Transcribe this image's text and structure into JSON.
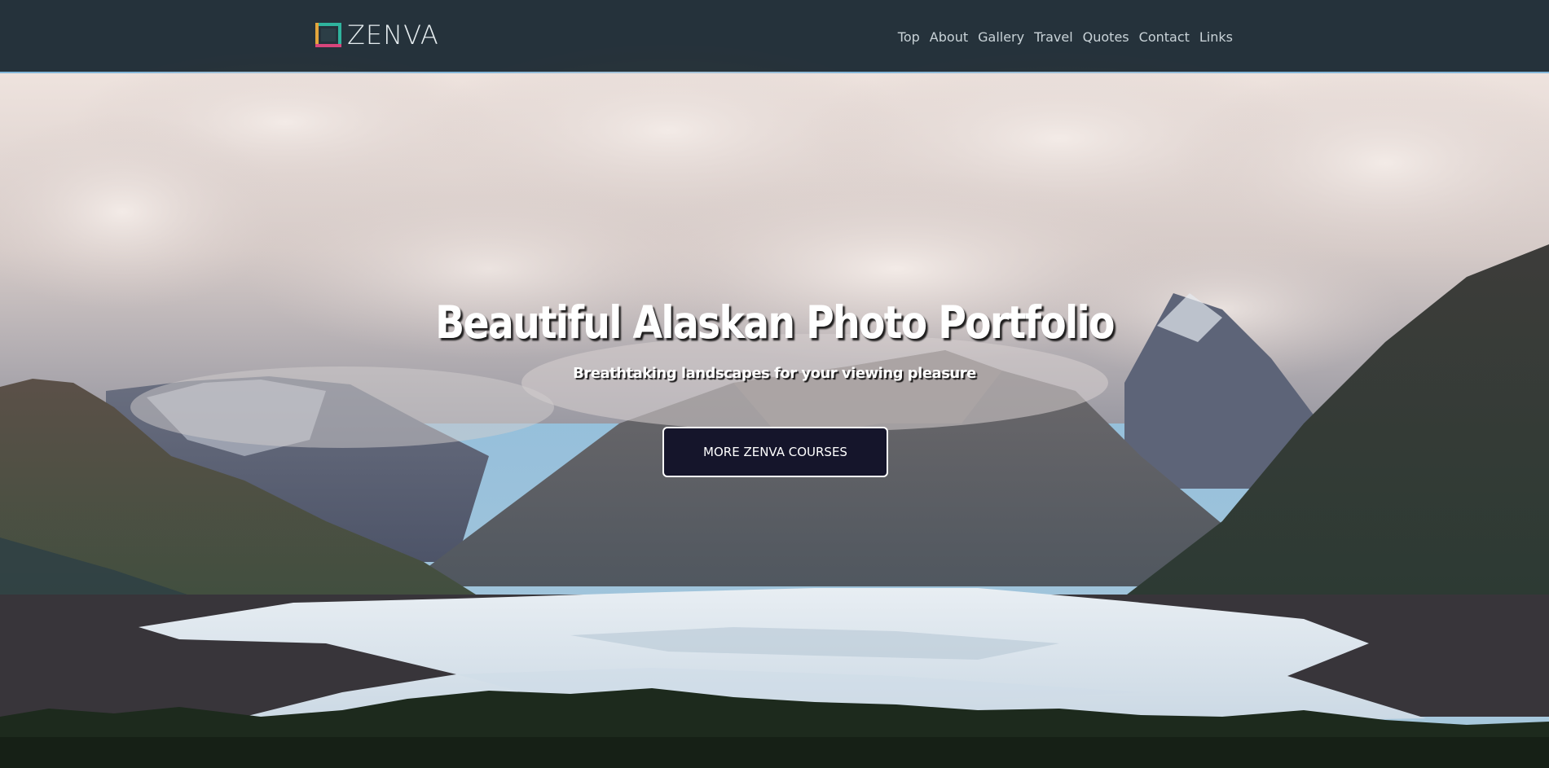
{
  "brand": {
    "name": "ZENVA",
    "logo_icon": "zenva-logo-icon",
    "logo_colors": [
      "#e3a53c",
      "#2fb39d",
      "#d8457b",
      "#5a8fd1"
    ]
  },
  "nav": {
    "items": [
      {
        "label": "Top"
      },
      {
        "label": "About"
      },
      {
        "label": "Gallery"
      },
      {
        "label": "Travel"
      },
      {
        "label": "Quotes"
      },
      {
        "label": "Contact"
      },
      {
        "label": "Links"
      }
    ]
  },
  "hero": {
    "title": "Beautiful Alaskan Photo Portfolio",
    "subtitle": "Breathtaking landscapes for your viewing pleasure",
    "button_label": "MORE ZENVA COURSES"
  },
  "colors": {
    "navbar_bg": "#1e282e",
    "button_bg": "#15152b",
    "text": "#ffffff"
  }
}
